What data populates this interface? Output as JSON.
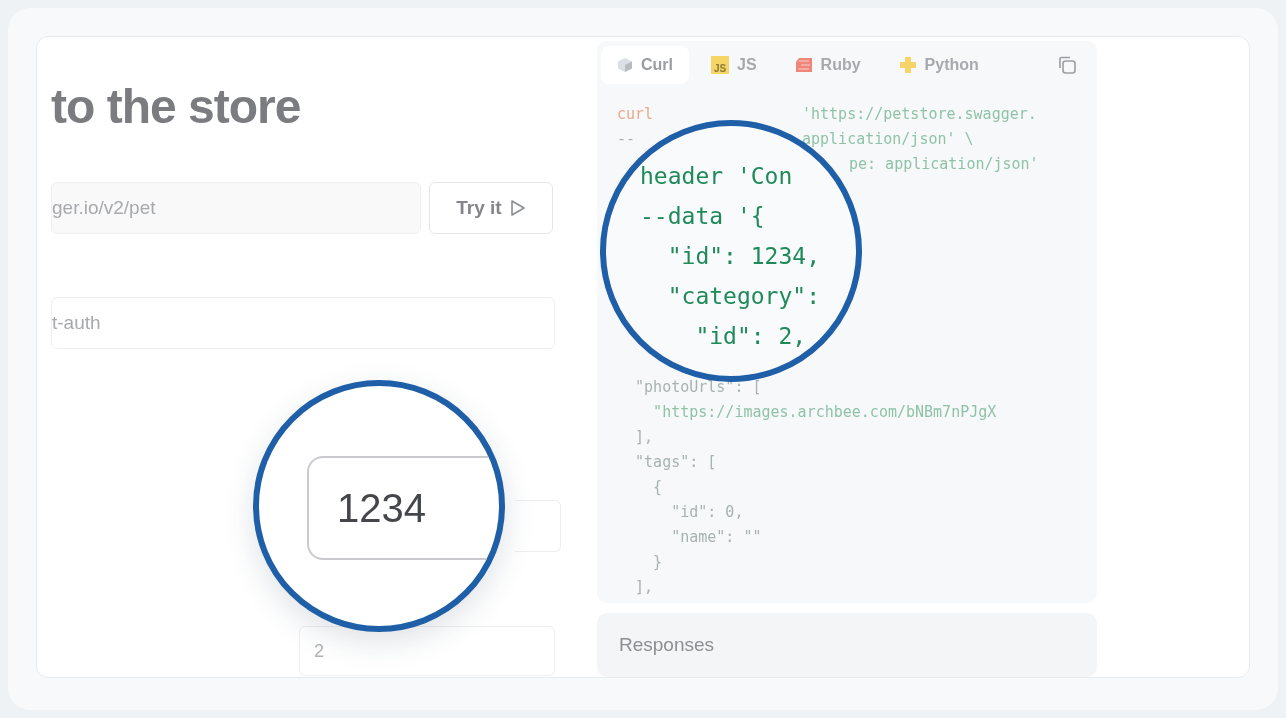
{
  "heading": "to the store",
  "url_field": {
    "value": "ger.io/v2/pet"
  },
  "try_button": {
    "label": "Try it"
  },
  "auth_field": {
    "value": "t-auth"
  },
  "number_field": {
    "placeholder": "2"
  },
  "code_panel": {
    "tabs": [
      {
        "label": "Curl",
        "selected": true,
        "kind": "curl"
      },
      {
        "label": "JS",
        "selected": false,
        "kind": "js",
        "icon_text": "JS"
      },
      {
        "label": "Ruby",
        "selected": false,
        "kind": "ruby"
      },
      {
        "label": "Python",
        "selected": false,
        "kind": "python"
      }
    ],
    "lines": [
      {
        "parts": [
          {
            "text": "curl",
            "kind": "keyword"
          },
          {
            "text": "'https://petstore.swagger.",
            "kind": "string"
          }
        ]
      },
      {
        "parts": [
          {
            "text": "--",
            "kind": "plain"
          },
          {
            "text": "application/json' \\",
            "kind": "string"
          }
        ]
      },
      {
        "parts": [
          {
            "text": "pe: application/json'",
            "kind": "string"
          }
        ]
      },
      {
        "parts": [
          {
            "text": "  \"photoUrls\": [",
            "kind": "plain"
          }
        ]
      },
      {
        "parts": [
          {
            "text": "    \"https://images.archbee.com/bNBm7nPJgX",
            "kind": "string"
          }
        ]
      },
      {
        "parts": [
          {
            "text": "  ],",
            "kind": "plain"
          }
        ]
      },
      {
        "parts": [
          {
            "text": "  \"tags\": [",
            "kind": "plain"
          }
        ]
      },
      {
        "parts": [
          {
            "text": "    {",
            "kind": "plain"
          }
        ]
      },
      {
        "parts": [
          {
            "text": "      \"id\": 0,",
            "kind": "plain"
          }
        ]
      },
      {
        "parts": [
          {
            "text": "      \"name\": \"\"",
            "kind": "plain"
          }
        ]
      },
      {
        "parts": [
          {
            "text": "    }",
            "kind": "plain"
          }
        ]
      },
      {
        "parts": [
          {
            "text": "  ],",
            "kind": "plain"
          }
        ]
      }
    ]
  },
  "magnifiers": [
    {
      "kind": "field",
      "value": "1234"
    },
    {
      "kind": "code",
      "lines": [
        "header 'Con",
        "--data '{",
        "  \"id\": 1234,",
        "  \"category\":",
        "    \"id\": 2,"
      ]
    }
  ],
  "responses": {
    "title": "Responses"
  }
}
